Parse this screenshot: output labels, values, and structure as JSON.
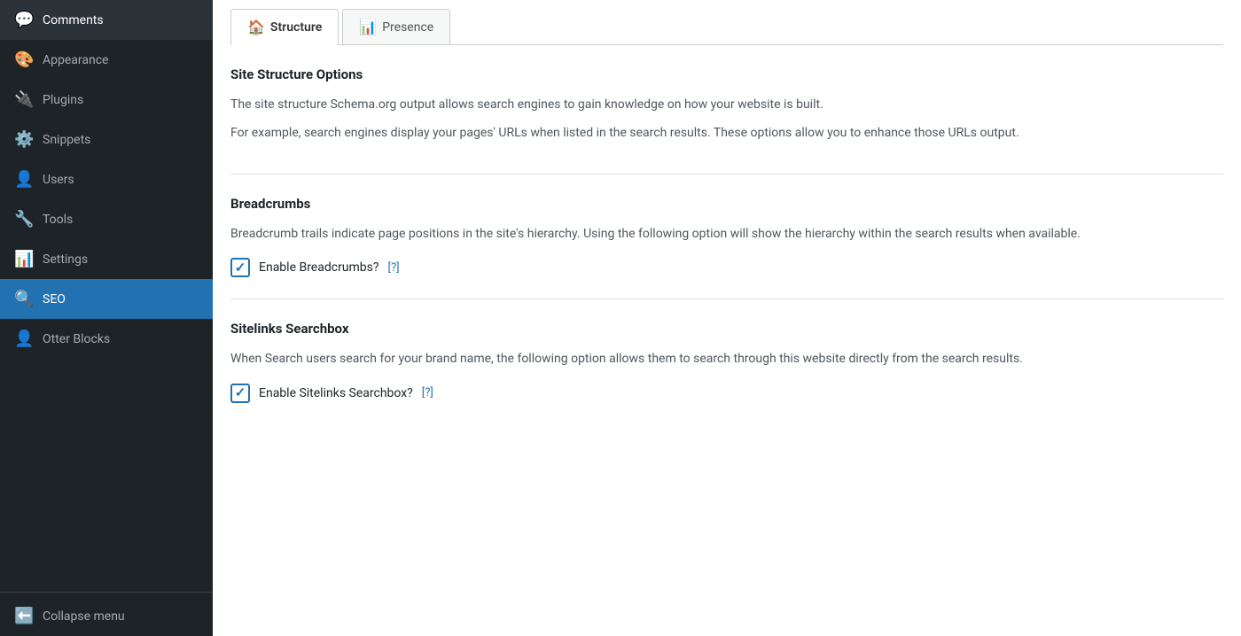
{
  "sidebar": {
    "items": [
      {
        "id": "comments",
        "label": "Comments",
        "icon": "💬",
        "active": false
      },
      {
        "id": "appearance",
        "label": "Appearance",
        "icon": "🎨",
        "active": false
      },
      {
        "id": "plugins",
        "label": "Plugins",
        "icon": "🔌",
        "active": false
      },
      {
        "id": "snippets",
        "label": "Snippets",
        "icon": "⚙️",
        "active": false
      },
      {
        "id": "users",
        "label": "Users",
        "icon": "👤",
        "active": false
      },
      {
        "id": "tools",
        "label": "Tools",
        "icon": "🔧",
        "active": false
      },
      {
        "id": "settings",
        "label": "Settings",
        "icon": "📊",
        "active": false
      },
      {
        "id": "seo",
        "label": "SEO",
        "icon": "🔍",
        "active": true
      },
      {
        "id": "otter-blocks",
        "label": "Otter Blocks",
        "icon": "👤",
        "active": false
      }
    ],
    "collapse_label": "Collapse menu"
  },
  "tabs": [
    {
      "id": "structure",
      "label": "Structure",
      "icon": "🏠",
      "active": true
    },
    {
      "id": "presence",
      "label": "Presence",
      "icon": "📊",
      "active": false
    }
  ],
  "sections": [
    {
      "id": "site-structure",
      "title": "Site Structure Options",
      "description1": "The site structure Schema.org output allows search engines to gain knowledge on how your website is built.",
      "description2": "For example, search engines display your pages' URLs when listed in the search results. These options allow you to enhance those URLs output.",
      "checkbox": null
    },
    {
      "id": "breadcrumbs",
      "title": "Breadcrumbs",
      "description1": "Breadcrumb trails indicate page positions in the site's hierarchy. Using the following option will show the hierarchy within the search results when available.",
      "description2": null,
      "checkbox": {
        "label": "Enable Breadcrumbs?",
        "help_text": "[?]",
        "checked": true
      }
    },
    {
      "id": "sitelinks-searchbox",
      "title": "Sitelinks Searchbox",
      "description1": "When Search users search for your brand name, the following option allows them to search through this website directly from the search results.",
      "description2": null,
      "checkbox": {
        "label": "Enable Sitelinks Searchbox?",
        "help_text": "[?]",
        "checked": true
      }
    }
  ]
}
